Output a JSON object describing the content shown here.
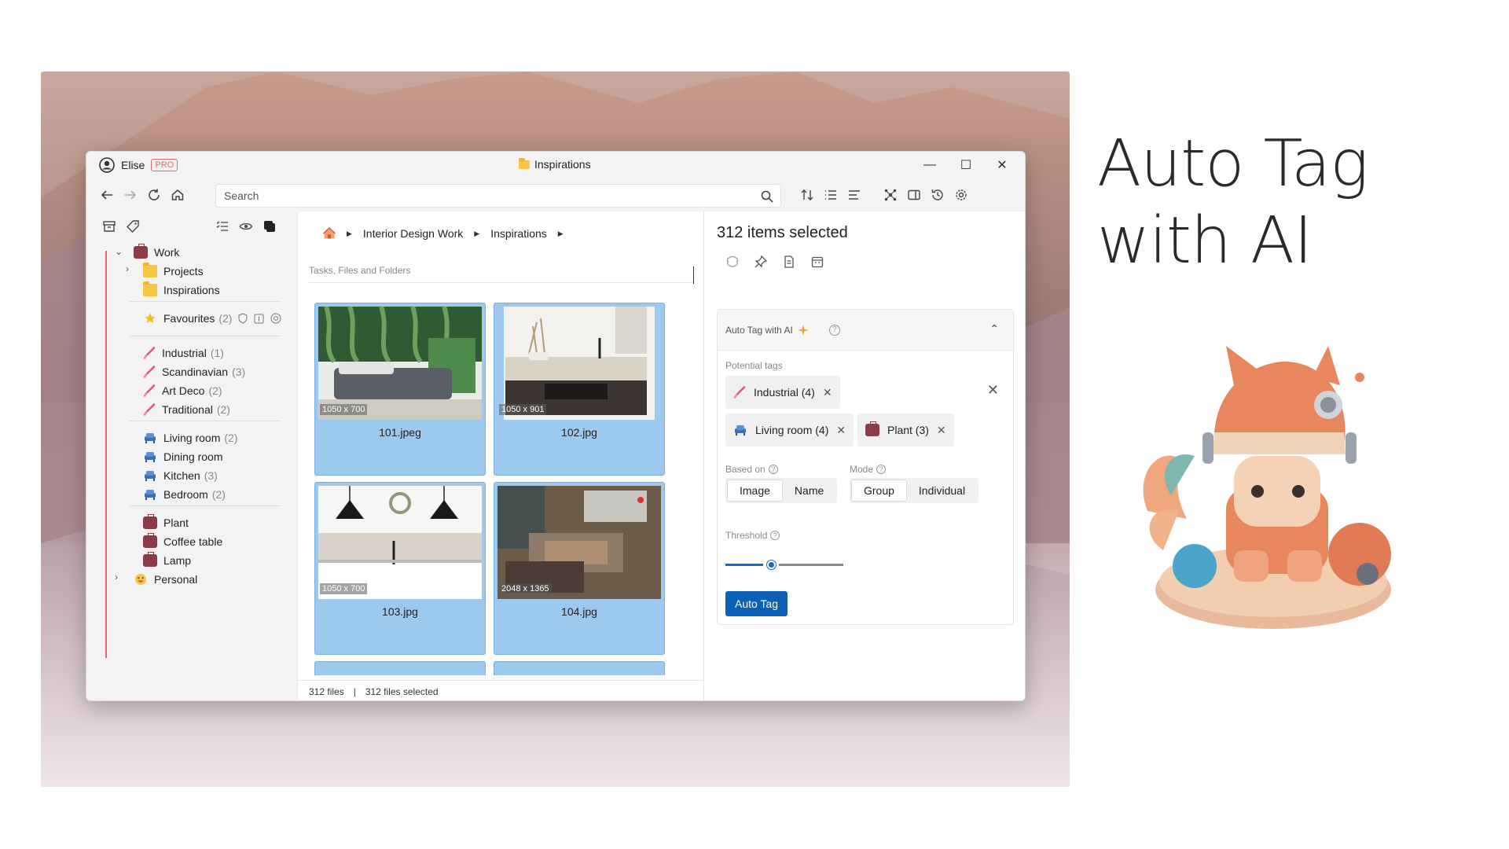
{
  "headline": {
    "line1": "Auto Tag",
    "line2": "with AI"
  },
  "window": {
    "user_name": "Elise",
    "plan_badge": "PRO",
    "title": "Inspirations",
    "controls": {
      "minimize": "—",
      "maximize": "☐",
      "close": "✕"
    }
  },
  "toolbar": {
    "search_placeholder": "Search"
  },
  "sidebar": {
    "work": {
      "label": "Work"
    },
    "projects": {
      "label": "Projects"
    },
    "inspirations": {
      "label": "Inspirations"
    },
    "favourites": {
      "label": "Favourites",
      "count": "(2)"
    },
    "styles": [
      {
        "label": "Industrial",
        "count": "(1)"
      },
      {
        "label": "Scandinavian",
        "count": "(3)"
      },
      {
        "label": "Art Deco",
        "count": "(2)"
      },
      {
        "label": "Traditional",
        "count": "(2)"
      }
    ],
    "rooms": [
      {
        "label": "Living room",
        "count": "(2)"
      },
      {
        "label": "Dining room",
        "count": ""
      },
      {
        "label": "Kitchen",
        "count": "(3)"
      },
      {
        "label": "Bedroom",
        "count": "(2)"
      }
    ],
    "objects": [
      {
        "label": "Plant"
      },
      {
        "label": "Coffee table"
      },
      {
        "label": "Lamp"
      }
    ],
    "personal": {
      "label": "Personal"
    }
  },
  "main": {
    "breadcrumb": [
      "Interior Design Work",
      "Inspirations"
    ],
    "section_label": "Tasks, Files and Folders",
    "files": [
      {
        "name": "101.jpeg",
        "dims": "1050 x 700"
      },
      {
        "name": "102.jpg",
        "dims": "1050 x 901"
      },
      {
        "name": "103.jpg",
        "dims": "1050 x 700"
      },
      {
        "name": "104.jpg",
        "dims": "2048 x 1365"
      }
    ],
    "status": {
      "files": "312 files",
      "divider": "|",
      "selected": "312 files selected"
    }
  },
  "panel": {
    "title": "312 items selected",
    "auto_tag_title": "Auto Tag with AI",
    "potential_tags_label": "Potential tags",
    "tags": [
      {
        "label": "Industrial (4)"
      },
      {
        "label": "Living room (4)"
      },
      {
        "label": "Plant (3)"
      }
    ],
    "based_on": {
      "label": "Based on",
      "options": [
        "Image",
        "Name"
      ],
      "selected": "Image"
    },
    "mode": {
      "label": "Mode",
      "options": [
        "Group",
        "Individual"
      ],
      "selected": "Group"
    },
    "threshold": {
      "label": "Threshold",
      "value": 0.35
    },
    "button_label": "Auto Tag"
  },
  "colors": {
    "accent": "#0b5fb5",
    "selection": "#9ec9ee",
    "tree_line": "#e06a6a",
    "pro_badge": "#e36a6a"
  }
}
